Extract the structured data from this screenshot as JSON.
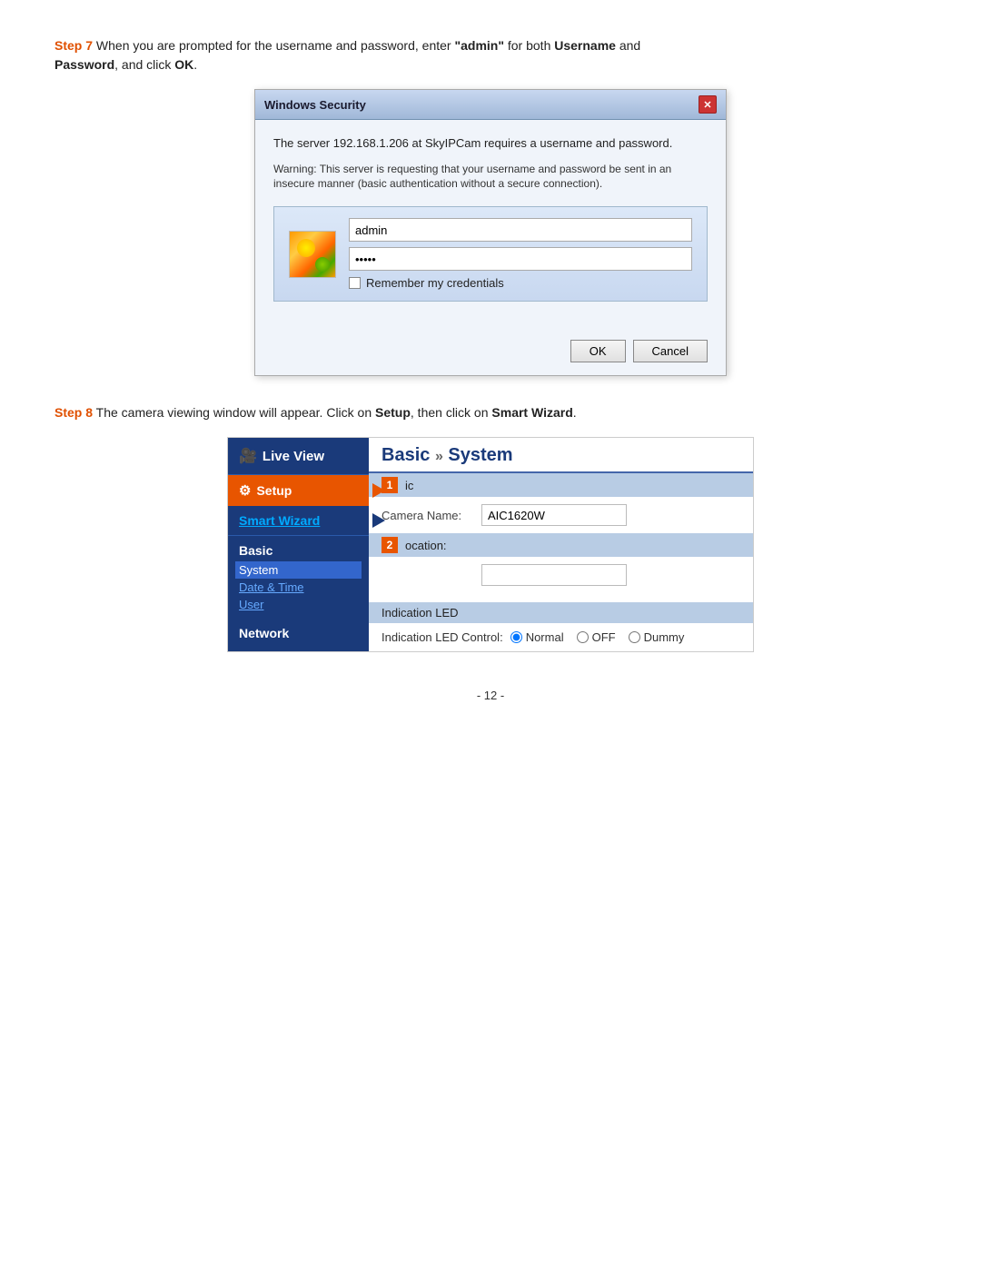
{
  "step7": {
    "label": "Step 7",
    "text": " When you are prompted for the username and password, enter ",
    "admin_quoted": "\"admin\"",
    "text2": " for both ",
    "username_bold": "Username",
    "text3": " and ",
    "password_bold": "Password",
    "text4": ", and click ",
    "ok_bold": "OK",
    "text5": "."
  },
  "dialog": {
    "title": "Windows Security",
    "close_label": "✕",
    "message": "The server 192.168.1.206 at SkyIPCam requires a username and password.",
    "warning": "Warning: This server is requesting that your username and password be sent in an insecure manner (basic authentication without a secure connection).",
    "username_value": "admin",
    "password_value": "•••••",
    "remember_label": "Remember my credentials",
    "ok_label": "OK",
    "cancel_label": "Cancel"
  },
  "step8": {
    "label": "Step 8",
    "text": " The camera viewing window will appear.  Click on ",
    "setup_bold": "Setup",
    "text2": ", then click on ",
    "smartwizard_bold": "Smart Wizard",
    "text3": "."
  },
  "camera_ui": {
    "sidebar": {
      "liveview_label": "Live View",
      "setup_label": "Setup",
      "setup_badge": "1",
      "smartwizard_label": "Smart Wizard",
      "smartwizard_badge": "2",
      "basic_title": "Basic",
      "system_link": "System",
      "datetime_link": "Date & Time",
      "user_link": "User",
      "network_title": "Network"
    },
    "main": {
      "header_basic": "Basic",
      "header_arrow": "»",
      "header_system": "System",
      "section1_label": "ic",
      "camera_name_label": "Camera Name:",
      "camera_name_value": "AIC1620W",
      "location_label": "ocation:",
      "location_value": "",
      "section2_label": "Indication LED",
      "led_control_label": "Indication LED Control:",
      "radio_normal": "Normal",
      "radio_off": "OFF",
      "radio_dummy": "Dummy"
    }
  },
  "page": {
    "number": "- 12 -"
  }
}
